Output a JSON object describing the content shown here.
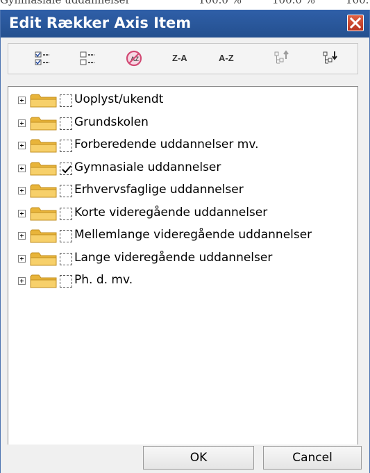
{
  "background": {
    "cutoff_texts": [
      "Gymnasiale uddannelser",
      "100.0 %",
      "100.0 %",
      "100."
    ]
  },
  "dialog": {
    "title": "Edit Rækker Axis Item",
    "close_icon": "close-icon"
  },
  "toolbar": {
    "buttons": [
      {
        "icon": "check-all-icon"
      },
      {
        "icon": "uncheck-all-icon"
      },
      {
        "icon": "no-sort-icon"
      },
      {
        "label": "Z-A",
        "icon": "sort-descending"
      },
      {
        "label": "A-Z",
        "icon": "sort-ascending"
      },
      {
        "icon": "move-up-icon"
      },
      {
        "icon": "move-down-icon"
      }
    ]
  },
  "tree": {
    "items": [
      {
        "label": "Uoplyst/ukendt",
        "checked": false
      },
      {
        "label": "Grundskolen",
        "checked": false
      },
      {
        "label": "Forberedende uddannelser mv.",
        "checked": false
      },
      {
        "label": "Gymnasiale uddannelser",
        "checked": true
      },
      {
        "label": "Erhvervsfaglige uddannelser",
        "checked": false
      },
      {
        "label": "Korte videregående uddannelser",
        "checked": false
      },
      {
        "label": "Mellemlange videregående uddannelser",
        "checked": false
      },
      {
        "label": "Lange videregående uddannelser",
        "checked": false
      },
      {
        "label": "Ph. d. mv.",
        "checked": false
      }
    ]
  },
  "footer": {
    "ok_label": "OK",
    "cancel_label": "Cancel"
  },
  "colors": {
    "titlebar": "#2f5fa8",
    "folder": "#f2c04a",
    "close": "#c9412a"
  }
}
